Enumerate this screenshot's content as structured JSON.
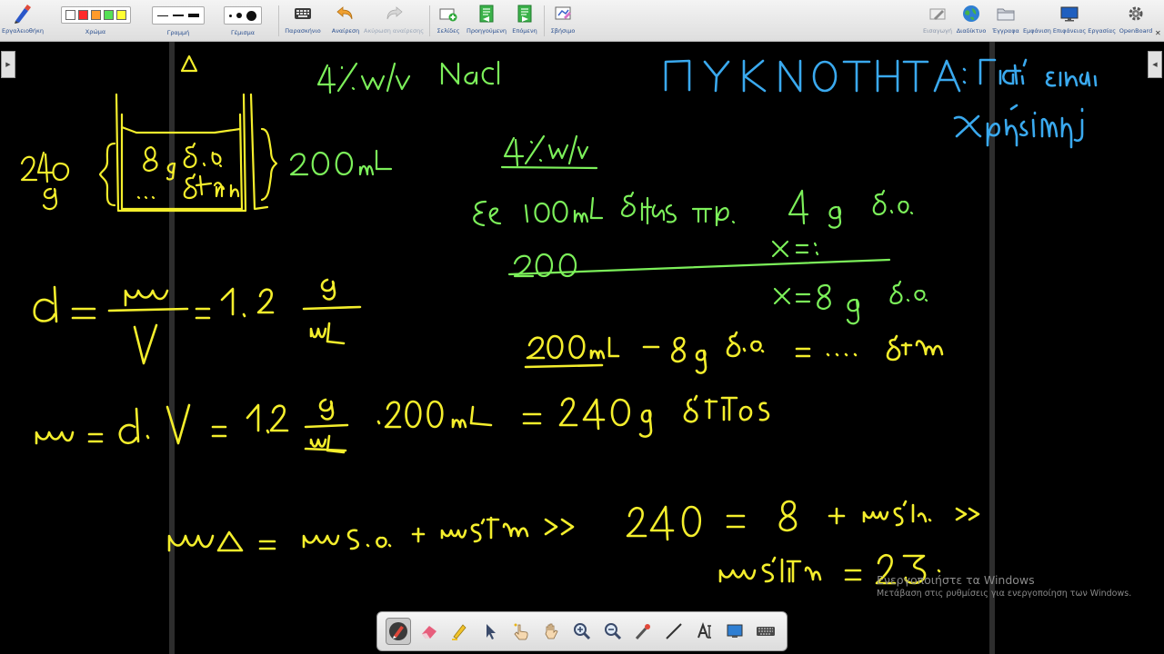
{
  "toolbar": {
    "tools_label": "Εργαλειοθήκη",
    "color_label": "Χρώμα",
    "line_label": "Γραμμή",
    "fill_label": "Γέμισμα",
    "display_label": "Παρασκήνιο",
    "undo_label": "Αναίρεση",
    "redo_label": "Ακύρωση αναίρεσης",
    "pages_label": "Σελίδες",
    "previous_label": "Προηγούμενη",
    "next_label": "Επόμενη",
    "erase_label": "Σβήσιμο",
    "import_label": "Εισαγωγή",
    "web_label": "Διαδίκτυο",
    "documents_label": "Έγγραφα",
    "show_desktop_label": "Εμφάνιση Επιφάνειας Εργασίας",
    "openboard_label": "OpenBoard",
    "colors": [
      "#ffffff",
      "#ff2a2a",
      "#ff9a2a",
      "#55e055",
      "#ffff33"
    ]
  },
  "board": {
    "ink_yellow": "#f4ee2c",
    "ink_green": "#7cf05a",
    "ink_blue": "#3aa9ee"
  },
  "watermark": {
    "line1": "Ενεργοποιήστε τα Windows",
    "line2": "Μετάβαση στις ρυθμίσεις για ενεργοποίηση των Windows."
  }
}
